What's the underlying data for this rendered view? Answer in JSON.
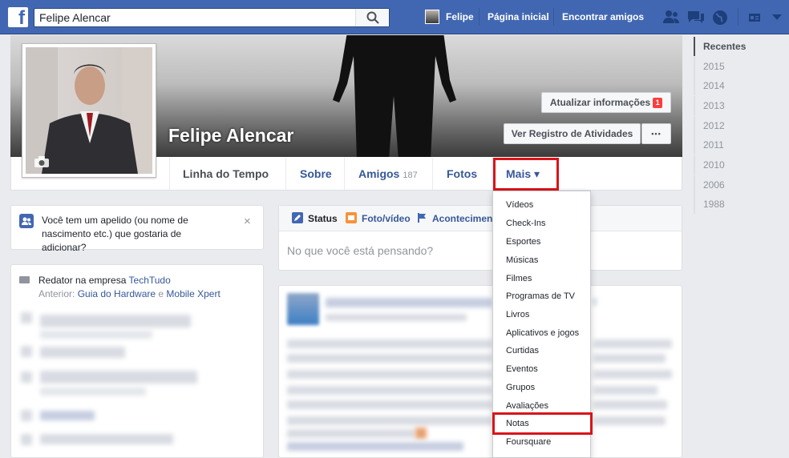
{
  "topbar": {
    "logo": "f",
    "search_value": "Felipe Alencar",
    "user_name": "Felipe",
    "home_label": "Página inicial",
    "find_friends_label": "Encontrar amigos"
  },
  "profile": {
    "name": "Felipe Alencar",
    "update_info_label": "Atualizar informações",
    "update_info_badge": "1",
    "activity_log_label": "Ver Registro de Atividades",
    "more_dots": "•••"
  },
  "tabs": {
    "timeline": "Linha do Tempo",
    "about": "Sobre",
    "friends": "Amigos",
    "friends_count": "187",
    "photos": "Fotos",
    "more": "Mais ▾"
  },
  "more_menu": {
    "items": [
      "Vídeos",
      "Check-Ins",
      "Esportes",
      "Músicas",
      "Filmes",
      "Programas de TV",
      "Livros",
      "Aplicativos e jogos",
      "Curtidas",
      "Eventos",
      "Grupos",
      "Avaliações",
      "Notas",
      "Foursquare"
    ]
  },
  "year_nav": {
    "items": [
      "Recentes",
      "2015",
      "2014",
      "2013",
      "2012",
      "2011",
      "2010",
      "2006",
      "1988"
    ]
  },
  "nickname_card": {
    "text": "Você tem um apelido (ou nome de nascimento etc.) que gostaria de adicionar?",
    "close": "×"
  },
  "intro": {
    "work_prefix": "Redator na empresa ",
    "work_company": "TechTudo",
    "previous_prefix": "Anterior: ",
    "previous_1": "Guia do Hardware",
    "previous_and": " e ",
    "previous_2": "Mobile Xpert"
  },
  "composer": {
    "status": "Status",
    "photo_video": "Foto/vídeo",
    "event": "Acontecimen",
    "placeholder": "No que você está pensando?"
  },
  "colors": {
    "brand": "#4267b2",
    "highlight": "#d9141a"
  }
}
